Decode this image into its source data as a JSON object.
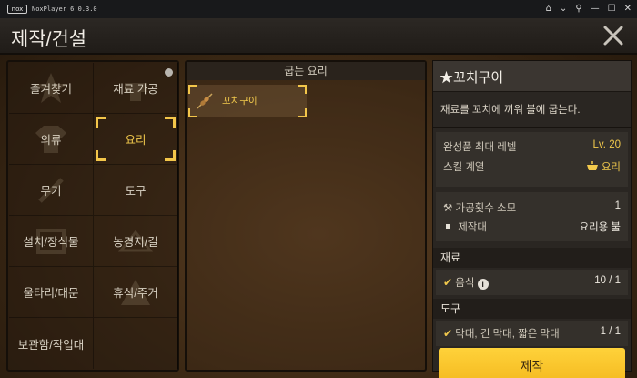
{
  "emulator": {
    "logo": "nox",
    "title": "NoxPlayer 6.0.3.0",
    "controls": [
      "home-icon",
      "chevron-down-icon",
      "pin-icon",
      "minimize-icon",
      "maximize-icon",
      "close-icon"
    ]
  },
  "page": {
    "title": "제작/건설",
    "close_icon": "close-icon"
  },
  "categories": [
    {
      "label": "즐겨찾기",
      "selected": false
    },
    {
      "label": "재료 가공",
      "selected": false,
      "notification": true
    },
    {
      "label": "의류",
      "selected": false
    },
    {
      "label": "요리",
      "selected": true
    },
    {
      "label": "무기",
      "selected": false
    },
    {
      "label": "도구",
      "selected": false
    },
    {
      "label": "설치/장식물",
      "selected": false
    },
    {
      "label": "농경지/길",
      "selected": false
    },
    {
      "label": "울타리/대문",
      "selected": false
    },
    {
      "label": "휴식/주거",
      "selected": false
    },
    {
      "label": "보관함/작업대",
      "selected": false
    }
  ],
  "recipe_list": {
    "header": "굽는 요리",
    "items": [
      {
        "name": "꼬치구이",
        "icon": "skewer-icon",
        "selected": true
      }
    ]
  },
  "detail": {
    "title": "★꼬치구이",
    "description": "재료를 꼬치에 끼워 불에 굽는다.",
    "max_level_label": "완성품 최대 레벨",
    "max_level_value": "Lv. 20",
    "skill_label": "스킬 계열",
    "skill_value": "요리",
    "craft_count_label": "가공횟수 소모",
    "craft_count_value": "1",
    "workbench_label": "제작대",
    "workbench_value": "요리용 불",
    "materials_header": "재료",
    "materials": [
      {
        "name": "음식",
        "have": "10 / 1"
      }
    ],
    "tools_header": "도구",
    "tools": [
      {
        "name": "막대, 긴 막대, 짧은 막대",
        "have": "1 / 1"
      }
    ],
    "craft_button": "제작"
  },
  "colors": {
    "accent_gold": "#f2c94c",
    "craft_button": "#f4b91f"
  }
}
